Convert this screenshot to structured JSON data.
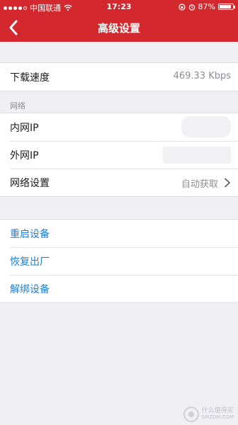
{
  "status_bar": {
    "carrier": "中国联通",
    "time": "17:23",
    "battery": "87%"
  },
  "header": {
    "title": "高级设置",
    "back_icon": "chevron-left-icon"
  },
  "speed_group": {
    "download_label": "下载速度",
    "download_value": "469.33 Kbps"
  },
  "network_section": {
    "section_label": "网络",
    "lan_ip_label": "内网IP",
    "wan_ip_label": "外网IP",
    "network_settings_label": "网络设置",
    "network_settings_value": "自动获取"
  },
  "actions": {
    "restart_label": "重启设备",
    "factory_reset_label": "恢复出厂",
    "unbind_label": "解绑设备"
  },
  "watermark": {
    "cn": "什么值得买",
    "en": "SMZDM.COM"
  },
  "colors": {
    "header_bg": "#d2282e",
    "action_text": "#1e7fd8",
    "page_bg": "#efeff4"
  }
}
